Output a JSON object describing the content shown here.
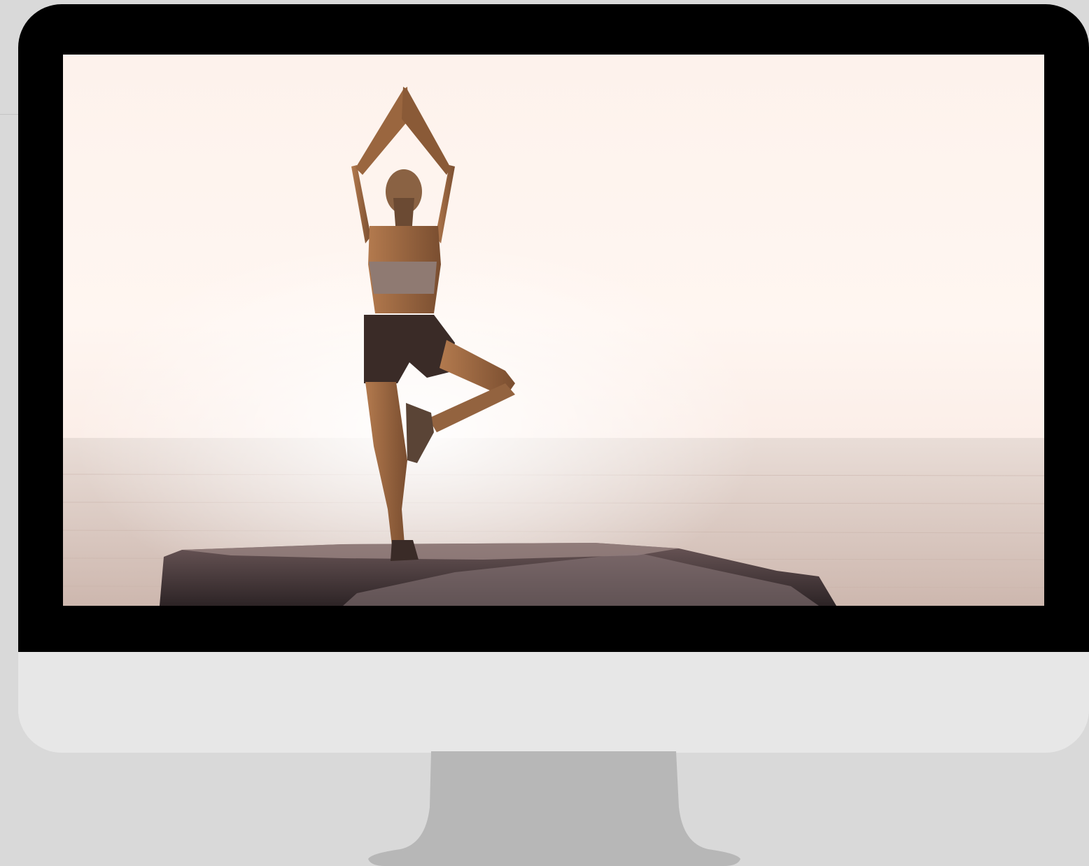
{
  "scene": {
    "colors": {
      "background": "#d9d9d9",
      "bezel": "#000000",
      "chin": "#e7e7e7",
      "stand": "#b7b7b7",
      "sky": "#fdf3ee",
      "sea": "#d9c5bd",
      "rock": "#3b3233",
      "silhouette": "#3a2b27"
    },
    "icons": {
      "monitor": "desktop-monitor-icon",
      "stand": "monitor-stand-icon"
    }
  }
}
